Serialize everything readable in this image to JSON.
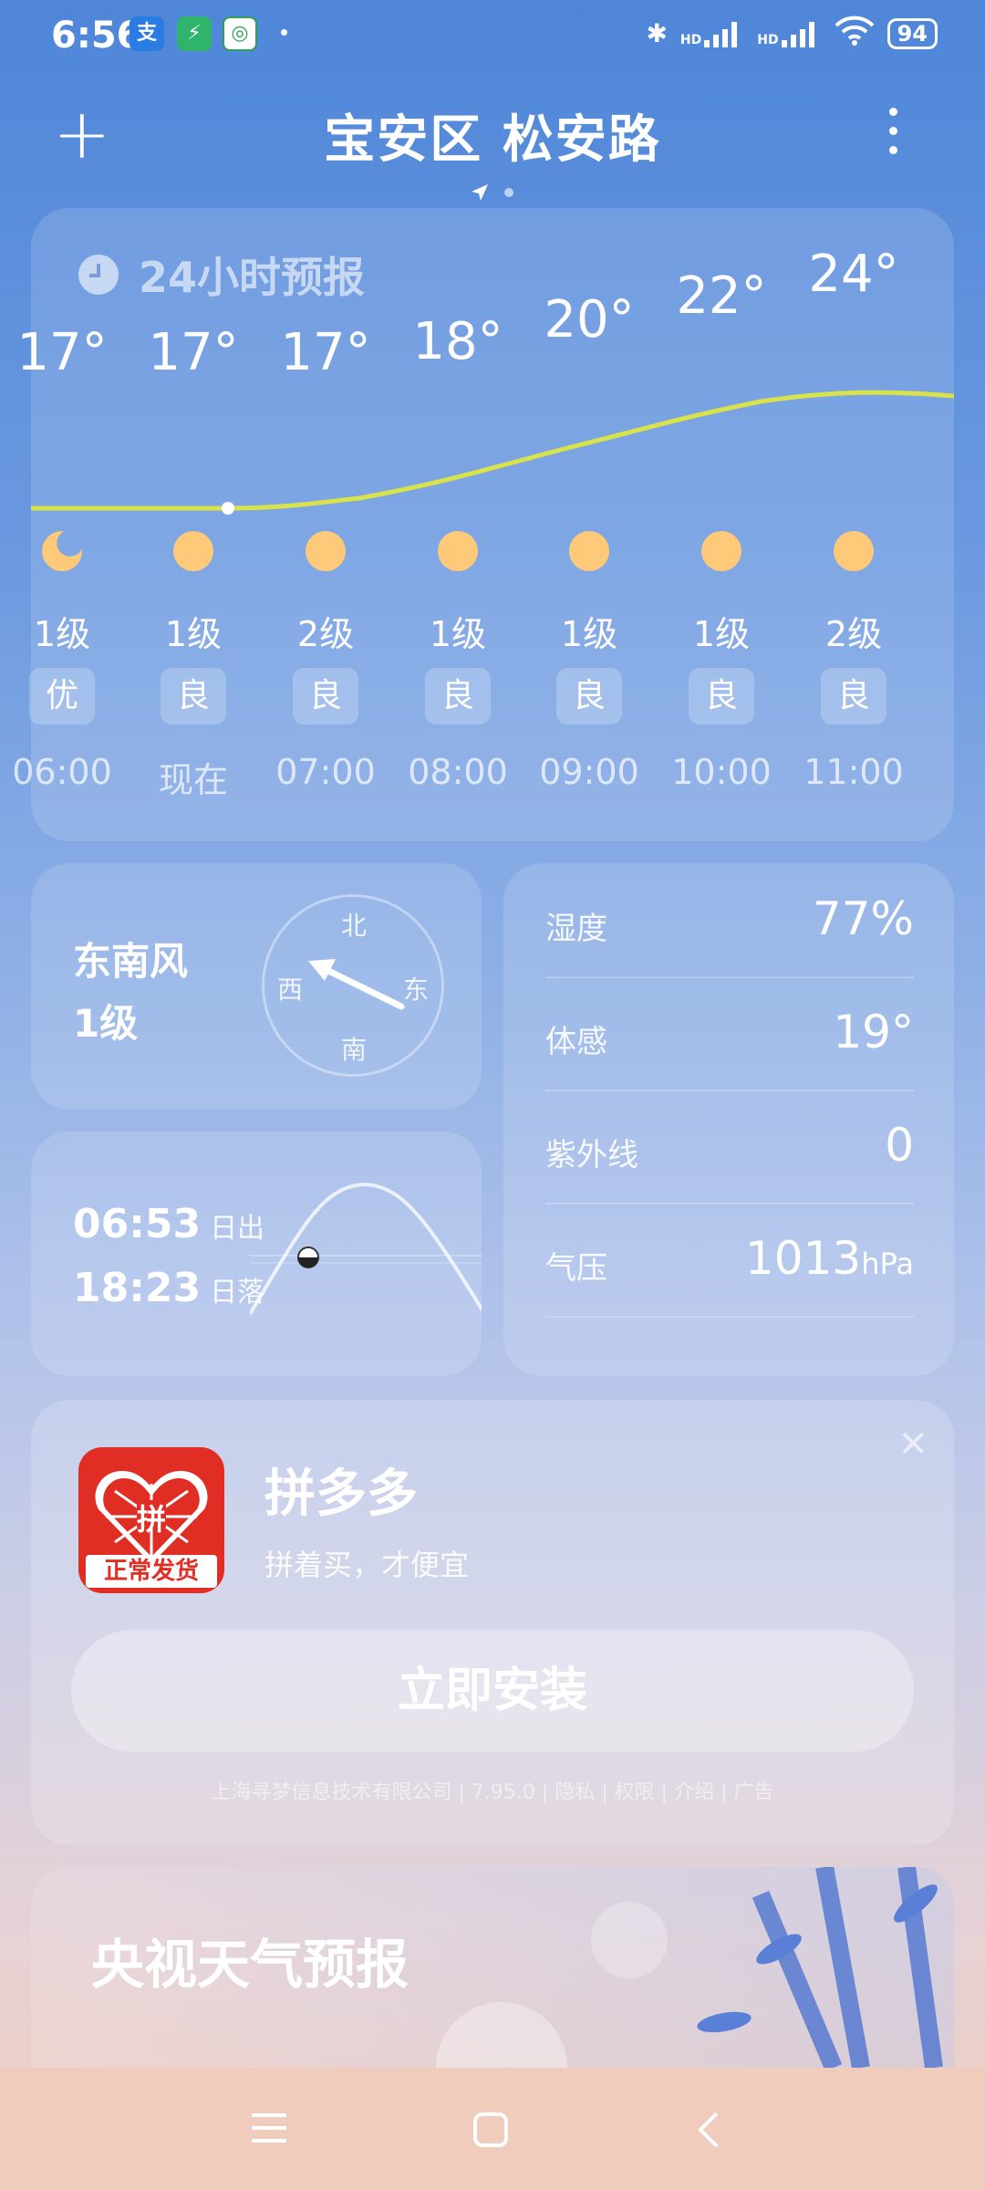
{
  "status": {
    "time": "6:56",
    "battery": "94",
    "hd1": "HD",
    "hd2": "HD"
  },
  "header": {
    "title": "宝安区 松安路"
  },
  "forecast": {
    "heading": "24小时预报",
    "hours": [
      {
        "temp": "17°",
        "wind": "1级",
        "aqi": "优",
        "time": "06:00",
        "icon": "moon-icon"
      },
      {
        "temp": "17°",
        "wind": "1级",
        "aqi": "良",
        "time": "现在",
        "icon": "sun-icon"
      },
      {
        "temp": "17°",
        "wind": "2级",
        "aqi": "良",
        "time": "07:00",
        "icon": "sun-icon"
      },
      {
        "temp": "18°",
        "wind": "1级",
        "aqi": "良",
        "time": "08:00",
        "icon": "sun-icon"
      },
      {
        "temp": "20°",
        "wind": "1级",
        "aqi": "良",
        "time": "09:00",
        "icon": "sun-icon"
      },
      {
        "temp": "22°",
        "wind": "1级",
        "aqi": "良",
        "time": "10:00",
        "icon": "sun-icon"
      },
      {
        "temp": "24°",
        "wind": "2级",
        "aqi": "良",
        "time": "11:00",
        "icon": "sun-icon"
      }
    ]
  },
  "wind": {
    "direction": "东南风",
    "level": "1级",
    "compass": {
      "n": "北",
      "s": "南",
      "e": "东",
      "w": "西"
    }
  },
  "sun": {
    "sunrise": "06:53",
    "sunrise_label": "日出",
    "sunset": "18:23",
    "sunset_label": "日落"
  },
  "details": [
    {
      "label": "湿度",
      "value": "77%",
      "unit": ""
    },
    {
      "label": "体感",
      "value": "19°",
      "unit": ""
    },
    {
      "label": "紫外线",
      "value": "0",
      "unit": ""
    },
    {
      "label": "气压",
      "value": "1013",
      "unit": "hPa"
    }
  ],
  "ad": {
    "name": "拼多多",
    "slogan": "拼着买，才便宜",
    "logo_text": "正常发货",
    "logo_char": "拼",
    "install": "立即安装",
    "footer": "上海寻梦信息技术有限公司 | 7.95.0 | 隐私 | 权限 | 介绍 | 广告"
  },
  "cctv": {
    "title": "央视天气预报"
  },
  "colors": {
    "curve": "#d8e24a",
    "sun": "#ffc97a",
    "pdd_red": "#e02e24"
  }
}
